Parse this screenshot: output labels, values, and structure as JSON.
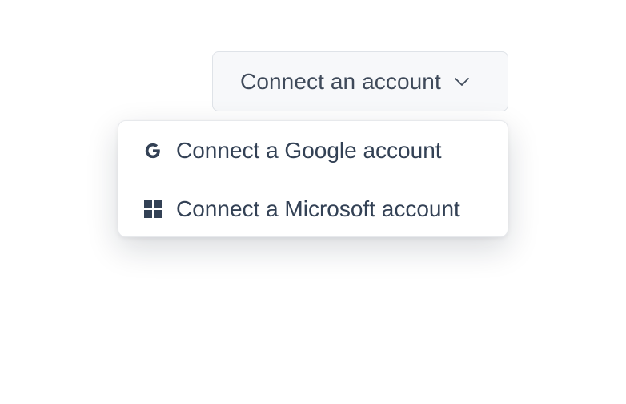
{
  "dropdown": {
    "trigger_label": "Connect an account",
    "items": [
      {
        "label": "Connect a Google account",
        "icon": "google-icon"
      },
      {
        "label": "Connect a Microsoft account",
        "icon": "microsoft-icon"
      }
    ]
  },
  "colors": {
    "text": "#334155",
    "trigger_bg": "#f7f8fa",
    "border": "#dfe3e8"
  }
}
